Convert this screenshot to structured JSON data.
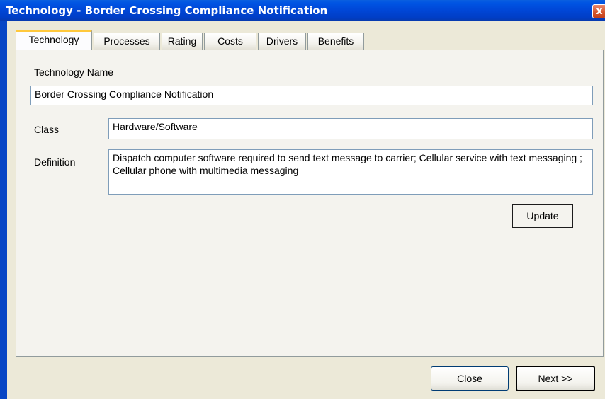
{
  "window": {
    "title": "Technology - Border Crossing Compliance Notification",
    "close_glyph": "x"
  },
  "tabs": [
    {
      "label": "Technology",
      "active": true
    },
    {
      "label": "Processes",
      "active": false
    },
    {
      "label": "Rating",
      "active": false
    },
    {
      "label": "Costs",
      "active": false
    },
    {
      "label": "Drivers",
      "active": false
    },
    {
      "label": "Benefits",
      "active": false
    }
  ],
  "form": {
    "technology_name_label": "Technology Name",
    "technology_name_value": "Border Crossing Compliance Notification",
    "class_label": "Class",
    "class_value": "Hardware/Software",
    "definition_label": "Definition",
    "definition_value": "Dispatch computer software required to send text message to carrier; Cellular service with text messaging ; Cellular phone with multimedia messaging",
    "update_label": "Update"
  },
  "footer": {
    "close_label": "Close",
    "next_label": "Next >>"
  },
  "colors": {
    "titlebar": "#0054e3",
    "dialog_face": "#ece9d8",
    "panel": "#f4f3ee",
    "active_tab_accent": "#ffc83c"
  }
}
